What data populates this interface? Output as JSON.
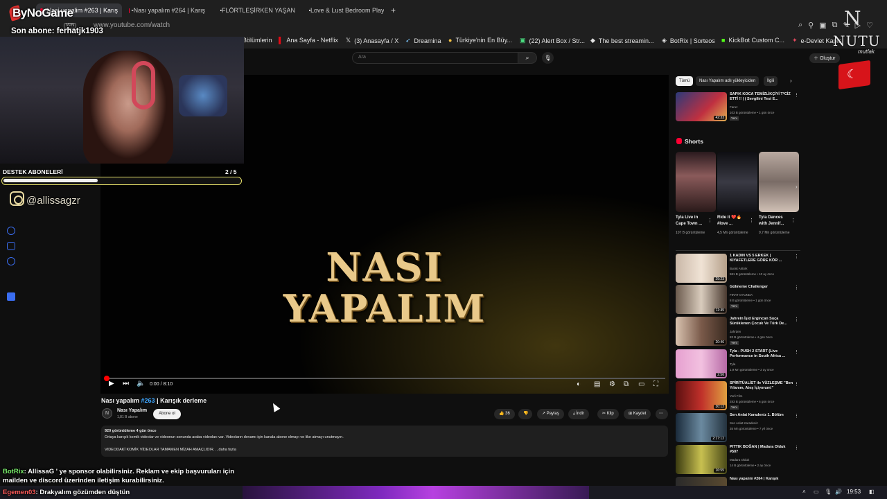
{
  "browser": {
    "tabs": [
      {
        "label": "Nasi yapalim #263 | Karış"
      },
      {
        "label": "Nası yapalım #264 | Karış"
      },
      {
        "label": "FLÖRTLEŞİRKEN YAŞANA"
      },
      {
        "label": "Love & Lust Bedroom Play"
      }
    ],
    "new_tab": "+",
    "url": "www.youtube.com/watch",
    "vpn": "VPN",
    "bookmarks": [
      {
        "label": "Bölümlerin"
      },
      {
        "label": "Ana Sayfa - Netflix"
      },
      {
        "label": "(3) Anasayfa / X"
      },
      {
        "label": "Dreamina"
      },
      {
        "label": "Türkiye'nin En Büy..."
      },
      {
        "label": "(22) Alert Box / Str..."
      },
      {
        "label": "The best streamin..."
      },
      {
        "label": "BotRix | Sorteos"
      },
      {
        "label": "KickBot Custom C..."
      },
      {
        "label": "e-Devlet Kapısı"
      }
    ]
  },
  "youtube": {
    "search_placeholder": "Ara",
    "create_label": "Oluştur",
    "player": {
      "title_line1": "NASI",
      "title_line2": "YAPALIM",
      "time": "0:00 / 8:10",
      "progress": 0.0
    },
    "video": {
      "title_prefix": "Nası yapalım ",
      "title_hash": "#263",
      "title_suffix": " | Karışık derleme",
      "channel": "Nası Yapalım",
      "subs": "1,81 B abone",
      "subscribe": "Abone ol",
      "likes": "36",
      "share": "Paylaş",
      "download": "İndir",
      "clip": "Klip",
      "save": "Kaydet",
      "views_date": "920 görüntüleme  4 gün önce",
      "desc1": "Ortaya karışık komik videolar ve videonun sonunda araba videoları var. Videoların devamı için kanala abone olmayı ve like atmayı unutmayın.",
      "desc2": "VIDEODAKİ KOMİK VİDEOLAR TAMAMEN MİZAH AMAÇLIDIR. ...daha fazla"
    },
    "chips": [
      {
        "label": "Tümü"
      },
      {
        "label": "Nası Yapalım adlı yükleyiciden"
      },
      {
        "label": "İlgili"
      }
    ],
    "recs_top": [
      {
        "title": "SAPIK KOCA TEMİZLİKÇİYİ T*CİZ ETTİ !! | ( Sevgilini Test E...",
        "channel": "Faruz",
        "meta": "103 B görüntüleme • 1 gün önce",
        "badge": "Yeni",
        "dur": "42:33"
      }
    ],
    "shorts_title": "Shorts",
    "shorts": [
      {
        "title": "Tyla Live in Cape Town ...",
        "meta": "107 B görüntüleme"
      },
      {
        "title": "Ride it ❤️🔥 #love ...",
        "meta": "4,5 Mn görüntüleme"
      },
      {
        "title": "Tyla Dances with Jennif...",
        "meta": "9,7 Mn görüntüleme"
      }
    ],
    "recs": [
      {
        "title": "1 KADIN VS 5 ERKEK | KIYAFETLERE GÖRE KÖR ...",
        "channel": "Burak Aktürk",
        "meta": "581 B görüntüleme • 10 ay önce",
        "badge": "",
        "dur": "29:23"
      },
      {
        "title": "Gülmeme Challenger",
        "channel": "FIRAT OYUNDA",
        "meta": "8 B görüntüleme • 1 gün önce",
        "badge": "Yeni",
        "dur": "11:45"
      },
      {
        "title": "Jahrein İşid Ergincan Suça Sürüklenen Çocuk Ve Türk De...",
        "channel": "Jahrden",
        "meta": "83 B görüntüleme • 4 gün önce",
        "badge": "Yeni",
        "dur": "20:46"
      },
      {
        "title": "Tyla - PUSH 2 START (Live Performance in South Africa ...",
        "channel": "Tyla",
        "meta": "1,9 Mn görüntüleme • 2 ay önce",
        "badge": "",
        "dur": "2:56"
      },
      {
        "title": "SPİRİTÜALİST ile YÜZLEŞME \"Ben Yılanım, Ateş İçiyorum!\"",
        "channel": "Yerli Film",
        "meta": "283 B görüntüleme • 6 gün önce",
        "badge": "Yeni",
        "dur": "30:12"
      },
      {
        "title": "Sen Anlat Karadeniz 1. Bölüm",
        "channel": "Sen Anlat Karadeniz",
        "meta": "35 Mn görüntüleme • 7 yıl önce",
        "badge": "",
        "dur": "2:17:12"
      },
      {
        "title": "PITTIK BOĞAN | Madara Olduk #507",
        "channel": "Madara Olduk",
        "meta": "14 B görüntüleme • 2 ay önce",
        "badge": "",
        "dur": "16:55"
      },
      {
        "title": "Nası yapalım #264 | Karışık",
        "channel": "",
        "meta": "",
        "badge": "",
        "dur": ""
      }
    ]
  },
  "overlay": {
    "logo": "ByNoGame",
    "last_sub": "Son abone: ferhatjk1903",
    "goal_label": "DESTEK ABONELERİ",
    "goal_count": "2 / 5",
    "goal_fraction": 0.4,
    "instagram": "@allissagzr",
    "brand": "NUTU",
    "brand_sub": "mutfak",
    "brand_mark": "N",
    "chat": [
      {
        "user": "BotRix",
        "text": ": AllissaG ' ye sponsor olabilirsiniz. Reklam ve ekip başvuruları için"
      },
      {
        "user": "",
        "text": "mailden ve discord üzerinden iletişim kurabilirsiniz."
      },
      {
        "user": "Egemen03",
        "text": ": Drakyalım gözümden düştün"
      }
    ]
  },
  "taskbar": {
    "clock": "19:53"
  },
  "colors": {
    "yt_red": "#ff0033",
    "goal_border": "#e8e26a",
    "link_blue": "#3ea6ff"
  }
}
